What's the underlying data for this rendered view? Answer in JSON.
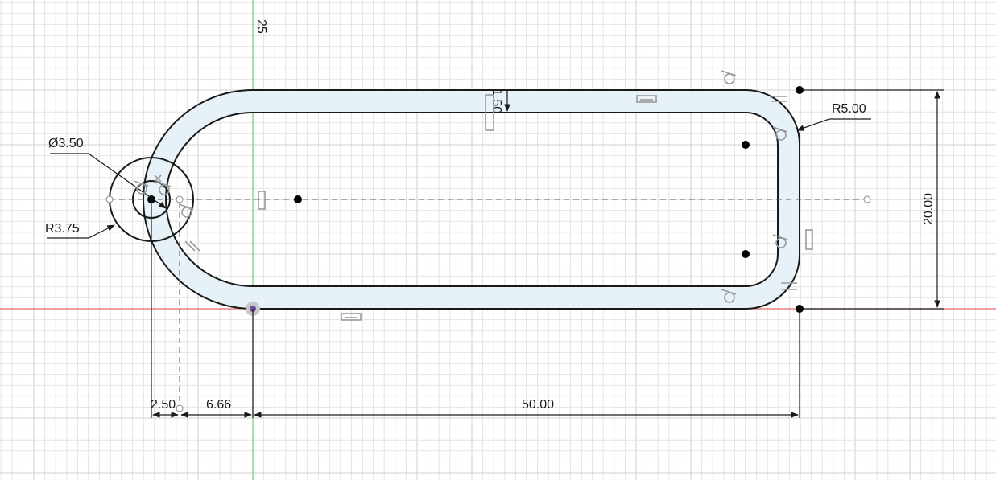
{
  "view": {
    "name": "sketch-canvas",
    "accent_colors": {
      "x_axis": "#e8696b",
      "y_axis": "#6bd36b",
      "profile_fill": "#e6f1f8",
      "line": "#1a1a1a",
      "grid_minor": "#e4e4e4",
      "grid_major": "#cfcfcf"
    }
  },
  "dimensions": {
    "top_axis_label": "25",
    "hole_diameter": "Ø3.50",
    "hole_radius": "R3.75",
    "corner_radius": "R5.00",
    "height": "20.00",
    "offset_small": "2.50",
    "offset_medium": "6.66",
    "length": "50.00",
    "inner_offset": "1.50"
  },
  "constraint_icons": [
    "tangent-icon",
    "tangent-icon",
    "tangent-icon",
    "tangent-icon",
    "tangent-icon",
    "tangent-icon",
    "tangent-icon",
    "horizontal-icon",
    "horizontal-icon",
    "horizontal-icon",
    "vertical-icon",
    "vertical-icon",
    "vertical-icon",
    "parallel-icon",
    "parallel-icon",
    "fix-icon"
  ]
}
